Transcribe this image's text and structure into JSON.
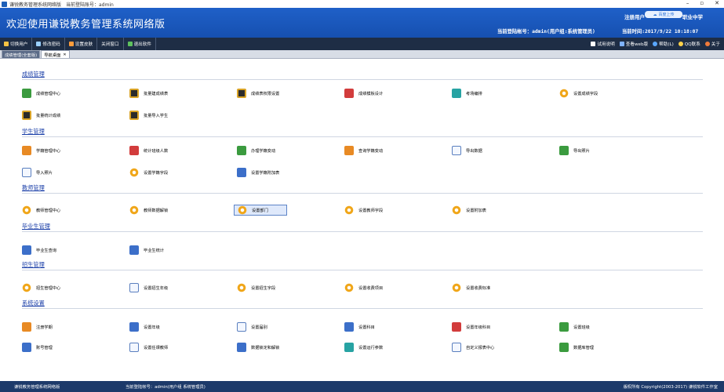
{
  "window": {
    "title": "谦锐教务管理系统网络版　当前登陆账号：admin",
    "min": "–",
    "max": "▫",
    "close": "✕"
  },
  "banner": {
    "welcome": "欢迎使用谦锐教务管理系统网络版",
    "registered": "注册用户",
    "logo_text": "百度上传",
    "school": "职业中学",
    "account": "当前登陆帐号：admin(用户组:系统管理员)",
    "time": "当前时间:2017/9/22 10:18:07"
  },
  "toolbar": {
    "switch_user": "切换用户",
    "change_pwd": "修改密码",
    "settings": "设置皮肤",
    "close_window": "关闭窗口",
    "exit": "退出软件",
    "trial": "试用说明",
    "web": "查看web版",
    "help": "帮助(L)",
    "qq": "QQ联系",
    "about": "关于"
  },
  "tabs": [
    "成绩管理(全套版)",
    "导航桌面"
  ],
  "sections": {
    "grades": {
      "title": "成绩管理",
      "items": [
        "成绩管理中心",
        "批量建成绩表",
        "成绩表权限设置",
        "成绩模板设计",
        "考场编排",
        "设置成绩字段",
        "批量统计成绩",
        "批量导入学生"
      ]
    },
    "students": {
      "title": "学生管理",
      "items": [
        "学籍管理中心",
        "统计班级人数",
        "办理学籍变动",
        "查询学籍变动",
        "导出数据",
        "导出照片",
        "导入照片",
        "设置学籍字段",
        "设置学籍附加表"
      ]
    },
    "teachers": {
      "title": "教师管理",
      "items": [
        "教师管理中心",
        "教师数据解锁",
        "设置部门",
        "设置教师字段",
        "设置附加表"
      ]
    },
    "graduates": {
      "title": "毕业生管理",
      "items": [
        "毕业生查询",
        "毕业生统计"
      ]
    },
    "enroll": {
      "title": "招生管理",
      "items": [
        "招生管理中心",
        "设置招生年级",
        "设置招生字段",
        "设置收费项目",
        "设置收费标准"
      ]
    },
    "system": {
      "title": "系统设置",
      "items": [
        "注册学期",
        "设置年级",
        "设置届别",
        "设置科目",
        "设置年级科目",
        "设置班级",
        "账号管理",
        "设置任课教师",
        "数据锁定和解锁",
        "设置运行参数",
        "自定义报表中心",
        "数据库管理"
      ]
    }
  },
  "status": {
    "app": "谦锐教务管理系统网络版",
    "account": "当前登陆帐号：admin(用户组 系统管理员)",
    "copyright": "版权所有 Copyright(2003-2017) 谦锐软件工作室"
  }
}
